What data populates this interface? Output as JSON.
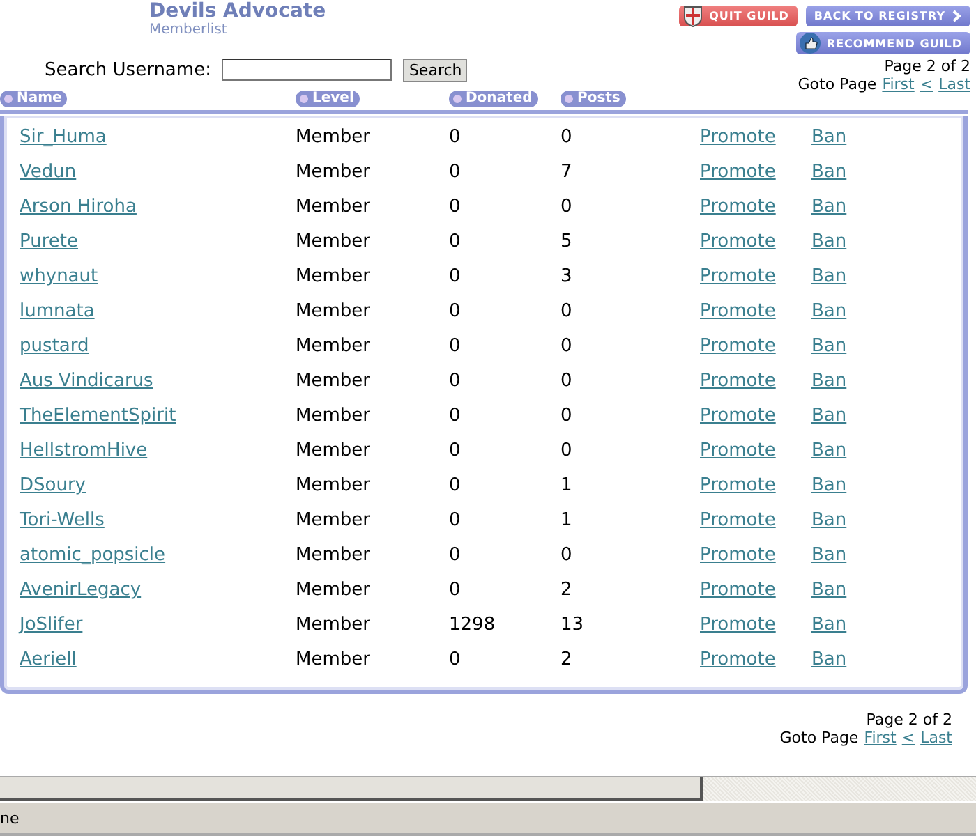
{
  "guild": {
    "title": "Devils Advocate",
    "subtitle": "Memberlist"
  },
  "actions": [
    {
      "label": "QUIT GUILD",
      "kind": "quit"
    },
    {
      "label": "BACK TO REGISTRY",
      "kind": "back"
    },
    {
      "label": "RECOMMEND GUILD",
      "kind": "recommend"
    }
  ],
  "search": {
    "label": "Search Username:",
    "button": "Search"
  },
  "pager_top": {
    "page": "Page 2 of 2",
    "goto": "Goto Page",
    "links": [
      "First",
      "<",
      "Last"
    ]
  },
  "columns": [
    "Name",
    "Level",
    "Donated",
    "Posts"
  ],
  "rows": [
    {
      "name": "Sir_Huma",
      "level": "Member",
      "donated": "0",
      "posts": "0",
      "promote": "Promote",
      "ban": "Ban"
    },
    {
      "name": "Vedun",
      "level": "Member",
      "donated": "0",
      "posts": "7",
      "promote": "Promote",
      "ban": "Ban"
    },
    {
      "name": "Arson Hiroha",
      "level": "Member",
      "donated": "0",
      "posts": "0",
      "promote": "Promote",
      "ban": "Ban"
    },
    {
      "name": "Purete",
      "level": "Member",
      "donated": "0",
      "posts": "5",
      "promote": "Promote",
      "ban": "Ban"
    },
    {
      "name": "whynaut",
      "level": "Member",
      "donated": "0",
      "posts": "3",
      "promote": "Promote",
      "ban": "Ban"
    },
    {
      "name": "lumnata",
      "level": "Member",
      "donated": "0",
      "posts": "0",
      "promote": "Promote",
      "ban": "Ban"
    },
    {
      "name": "pustard",
      "level": "Member",
      "donated": "0",
      "posts": "0",
      "promote": "Promote",
      "ban": "Ban"
    },
    {
      "name": "Aus Vindicarus",
      "level": "Member",
      "donated": "0",
      "posts": "0",
      "promote": "Promote",
      "ban": "Ban"
    },
    {
      "name": "TheElementSpirit",
      "level": "Member",
      "donated": "0",
      "posts": "0",
      "promote": "Promote",
      "ban": "Ban"
    },
    {
      "name": "HellstromHive",
      "level": "Member",
      "donated": "0",
      "posts": "0",
      "promote": "Promote",
      "ban": "Ban"
    },
    {
      "name": "DSoury",
      "level": "Member",
      "donated": "0",
      "posts": "1",
      "promote": "Promote",
      "ban": "Ban"
    },
    {
      "name": "Tori-Wells",
      "level": "Member",
      "donated": "0",
      "posts": "1",
      "promote": "Promote",
      "ban": "Ban"
    },
    {
      "name": "atomic_popsicle",
      "level": "Member",
      "donated": "0",
      "posts": "0",
      "promote": "Promote",
      "ban": "Ban"
    },
    {
      "name": "AvenirLegacy",
      "level": "Member",
      "donated": "0",
      "posts": "2",
      "promote": "Promote",
      "ban": "Ban"
    },
    {
      "name": "JoSlifer",
      "level": "Member",
      "donated": "1298",
      "posts": "13",
      "promote": "Promote",
      "ban": "Ban"
    },
    {
      "name": "Aeriell",
      "level": "Member",
      "donated": "0",
      "posts": "2",
      "promote": "Promote",
      "ban": "Ban"
    }
  ],
  "pager_bottom": {
    "page": "Page 2 of 2",
    "goto": "Goto Page",
    "links": [
      "First",
      "<",
      "Last"
    ]
  },
  "status_bar": {
    "text": "ne"
  }
}
